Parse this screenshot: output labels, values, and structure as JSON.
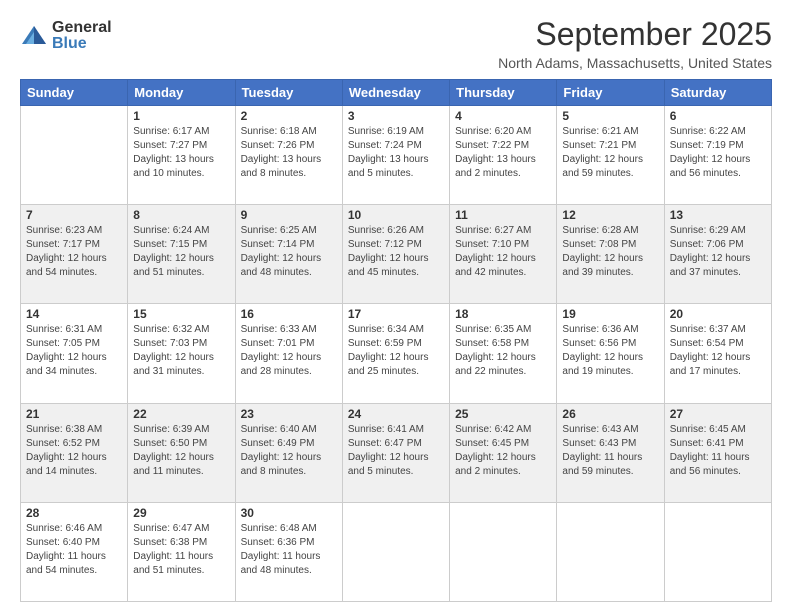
{
  "logo": {
    "general": "General",
    "blue": "Blue"
  },
  "title": "September 2025",
  "location": "North Adams, Massachusetts, United States",
  "days_of_week": [
    "Sunday",
    "Monday",
    "Tuesday",
    "Wednesday",
    "Thursday",
    "Friday",
    "Saturday"
  ],
  "weeks": [
    [
      {
        "day": "",
        "sunrise": "",
        "sunset": "",
        "daylight": ""
      },
      {
        "day": "1",
        "sunrise": "Sunrise: 6:17 AM",
        "sunset": "Sunset: 7:27 PM",
        "daylight": "Daylight: 13 hours and 10 minutes."
      },
      {
        "day": "2",
        "sunrise": "Sunrise: 6:18 AM",
        "sunset": "Sunset: 7:26 PM",
        "daylight": "Daylight: 13 hours and 8 minutes."
      },
      {
        "day": "3",
        "sunrise": "Sunrise: 6:19 AM",
        "sunset": "Sunset: 7:24 PM",
        "daylight": "Daylight: 13 hours and 5 minutes."
      },
      {
        "day": "4",
        "sunrise": "Sunrise: 6:20 AM",
        "sunset": "Sunset: 7:22 PM",
        "daylight": "Daylight: 13 hours and 2 minutes."
      },
      {
        "day": "5",
        "sunrise": "Sunrise: 6:21 AM",
        "sunset": "Sunset: 7:21 PM",
        "daylight": "Daylight: 12 hours and 59 minutes."
      },
      {
        "day": "6",
        "sunrise": "Sunrise: 6:22 AM",
        "sunset": "Sunset: 7:19 PM",
        "daylight": "Daylight: 12 hours and 56 minutes."
      }
    ],
    [
      {
        "day": "7",
        "sunrise": "Sunrise: 6:23 AM",
        "sunset": "Sunset: 7:17 PM",
        "daylight": "Daylight: 12 hours and 54 minutes."
      },
      {
        "day": "8",
        "sunrise": "Sunrise: 6:24 AM",
        "sunset": "Sunset: 7:15 PM",
        "daylight": "Daylight: 12 hours and 51 minutes."
      },
      {
        "day": "9",
        "sunrise": "Sunrise: 6:25 AM",
        "sunset": "Sunset: 7:14 PM",
        "daylight": "Daylight: 12 hours and 48 minutes."
      },
      {
        "day": "10",
        "sunrise": "Sunrise: 6:26 AM",
        "sunset": "Sunset: 7:12 PM",
        "daylight": "Daylight: 12 hours and 45 minutes."
      },
      {
        "day": "11",
        "sunrise": "Sunrise: 6:27 AM",
        "sunset": "Sunset: 7:10 PM",
        "daylight": "Daylight: 12 hours and 42 minutes."
      },
      {
        "day": "12",
        "sunrise": "Sunrise: 6:28 AM",
        "sunset": "Sunset: 7:08 PM",
        "daylight": "Daylight: 12 hours and 39 minutes."
      },
      {
        "day": "13",
        "sunrise": "Sunrise: 6:29 AM",
        "sunset": "Sunset: 7:06 PM",
        "daylight": "Daylight: 12 hours and 37 minutes."
      }
    ],
    [
      {
        "day": "14",
        "sunrise": "Sunrise: 6:31 AM",
        "sunset": "Sunset: 7:05 PM",
        "daylight": "Daylight: 12 hours and 34 minutes."
      },
      {
        "day": "15",
        "sunrise": "Sunrise: 6:32 AM",
        "sunset": "Sunset: 7:03 PM",
        "daylight": "Daylight: 12 hours and 31 minutes."
      },
      {
        "day": "16",
        "sunrise": "Sunrise: 6:33 AM",
        "sunset": "Sunset: 7:01 PM",
        "daylight": "Daylight: 12 hours and 28 minutes."
      },
      {
        "day": "17",
        "sunrise": "Sunrise: 6:34 AM",
        "sunset": "Sunset: 6:59 PM",
        "daylight": "Daylight: 12 hours and 25 minutes."
      },
      {
        "day": "18",
        "sunrise": "Sunrise: 6:35 AM",
        "sunset": "Sunset: 6:58 PM",
        "daylight": "Daylight: 12 hours and 22 minutes."
      },
      {
        "day": "19",
        "sunrise": "Sunrise: 6:36 AM",
        "sunset": "Sunset: 6:56 PM",
        "daylight": "Daylight: 12 hours and 19 minutes."
      },
      {
        "day": "20",
        "sunrise": "Sunrise: 6:37 AM",
        "sunset": "Sunset: 6:54 PM",
        "daylight": "Daylight: 12 hours and 17 minutes."
      }
    ],
    [
      {
        "day": "21",
        "sunrise": "Sunrise: 6:38 AM",
        "sunset": "Sunset: 6:52 PM",
        "daylight": "Daylight: 12 hours and 14 minutes."
      },
      {
        "day": "22",
        "sunrise": "Sunrise: 6:39 AM",
        "sunset": "Sunset: 6:50 PM",
        "daylight": "Daylight: 12 hours and 11 minutes."
      },
      {
        "day": "23",
        "sunrise": "Sunrise: 6:40 AM",
        "sunset": "Sunset: 6:49 PM",
        "daylight": "Daylight: 12 hours and 8 minutes."
      },
      {
        "day": "24",
        "sunrise": "Sunrise: 6:41 AM",
        "sunset": "Sunset: 6:47 PM",
        "daylight": "Daylight: 12 hours and 5 minutes."
      },
      {
        "day": "25",
        "sunrise": "Sunrise: 6:42 AM",
        "sunset": "Sunset: 6:45 PM",
        "daylight": "Daylight: 12 hours and 2 minutes."
      },
      {
        "day": "26",
        "sunrise": "Sunrise: 6:43 AM",
        "sunset": "Sunset: 6:43 PM",
        "daylight": "Daylight: 11 hours and 59 minutes."
      },
      {
        "day": "27",
        "sunrise": "Sunrise: 6:45 AM",
        "sunset": "Sunset: 6:41 PM",
        "daylight": "Daylight: 11 hours and 56 minutes."
      }
    ],
    [
      {
        "day": "28",
        "sunrise": "Sunrise: 6:46 AM",
        "sunset": "Sunset: 6:40 PM",
        "daylight": "Daylight: 11 hours and 54 minutes."
      },
      {
        "day": "29",
        "sunrise": "Sunrise: 6:47 AM",
        "sunset": "Sunset: 6:38 PM",
        "daylight": "Daylight: 11 hours and 51 minutes."
      },
      {
        "day": "30",
        "sunrise": "Sunrise: 6:48 AM",
        "sunset": "Sunset: 6:36 PM",
        "daylight": "Daylight: 11 hours and 48 minutes."
      },
      {
        "day": "",
        "sunrise": "",
        "sunset": "",
        "daylight": ""
      },
      {
        "day": "",
        "sunrise": "",
        "sunset": "",
        "daylight": ""
      },
      {
        "day": "",
        "sunrise": "",
        "sunset": "",
        "daylight": ""
      },
      {
        "day": "",
        "sunrise": "",
        "sunset": "",
        "daylight": ""
      }
    ]
  ]
}
